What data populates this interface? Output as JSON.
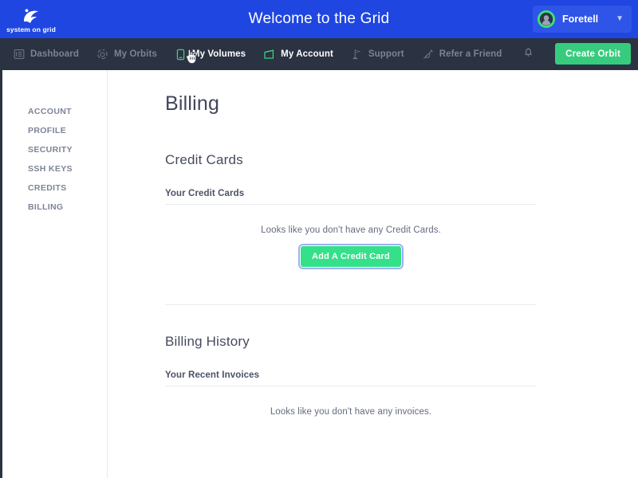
{
  "header": {
    "brand_name": "system on grid",
    "brand_icon": "sog-swoosh-logo",
    "title": "Welcome to the Grid",
    "user": {
      "name": "Foretell",
      "avatar_icon": "user-avatar",
      "chevron_icon": "chevron-down-icon"
    }
  },
  "nav": {
    "items": [
      {
        "label": "Dashboard",
        "icon": "dashboard-icon",
        "active": false
      },
      {
        "label": "My Orbits",
        "icon": "orbit-icon",
        "active": false
      },
      {
        "label": "My Volumes",
        "icon": "volume-icon",
        "active": true
      },
      {
        "label": "My Account",
        "icon": "account-icon",
        "active": true
      },
      {
        "label": "Support",
        "icon": "flag-icon",
        "active": false
      },
      {
        "label": "Refer a Friend",
        "icon": "satellite-icon",
        "active": false
      }
    ],
    "bell_icon": "bell-icon",
    "create_orbit_label": "Create Orbit"
  },
  "sidebar": {
    "items": [
      {
        "label": "ACCOUNT"
      },
      {
        "label": "PROFILE"
      },
      {
        "label": "SECURITY"
      },
      {
        "label": "SSH KEYS"
      },
      {
        "label": "CREDITS"
      },
      {
        "label": "BILLING"
      }
    ]
  },
  "main": {
    "page_title": "Billing",
    "credit_cards": {
      "section_title": "Credit Cards",
      "sub_head": "Your Credit Cards",
      "empty_message": "Looks like you don't have any Credit Cards.",
      "add_button_label": "Add A Credit Card"
    },
    "billing_history": {
      "section_title": "Billing History",
      "sub_head": "Your Recent Invoices",
      "empty_message": "Looks like you don't have any invoices."
    }
  },
  "colors": {
    "header_blue": "#1f46e0",
    "nav_dark": "#2b3242",
    "accent_green": "#34e08a",
    "create_orbit_green": "#37cc7d"
  },
  "cursor": {
    "icon": "pointer-hand-cursor"
  }
}
